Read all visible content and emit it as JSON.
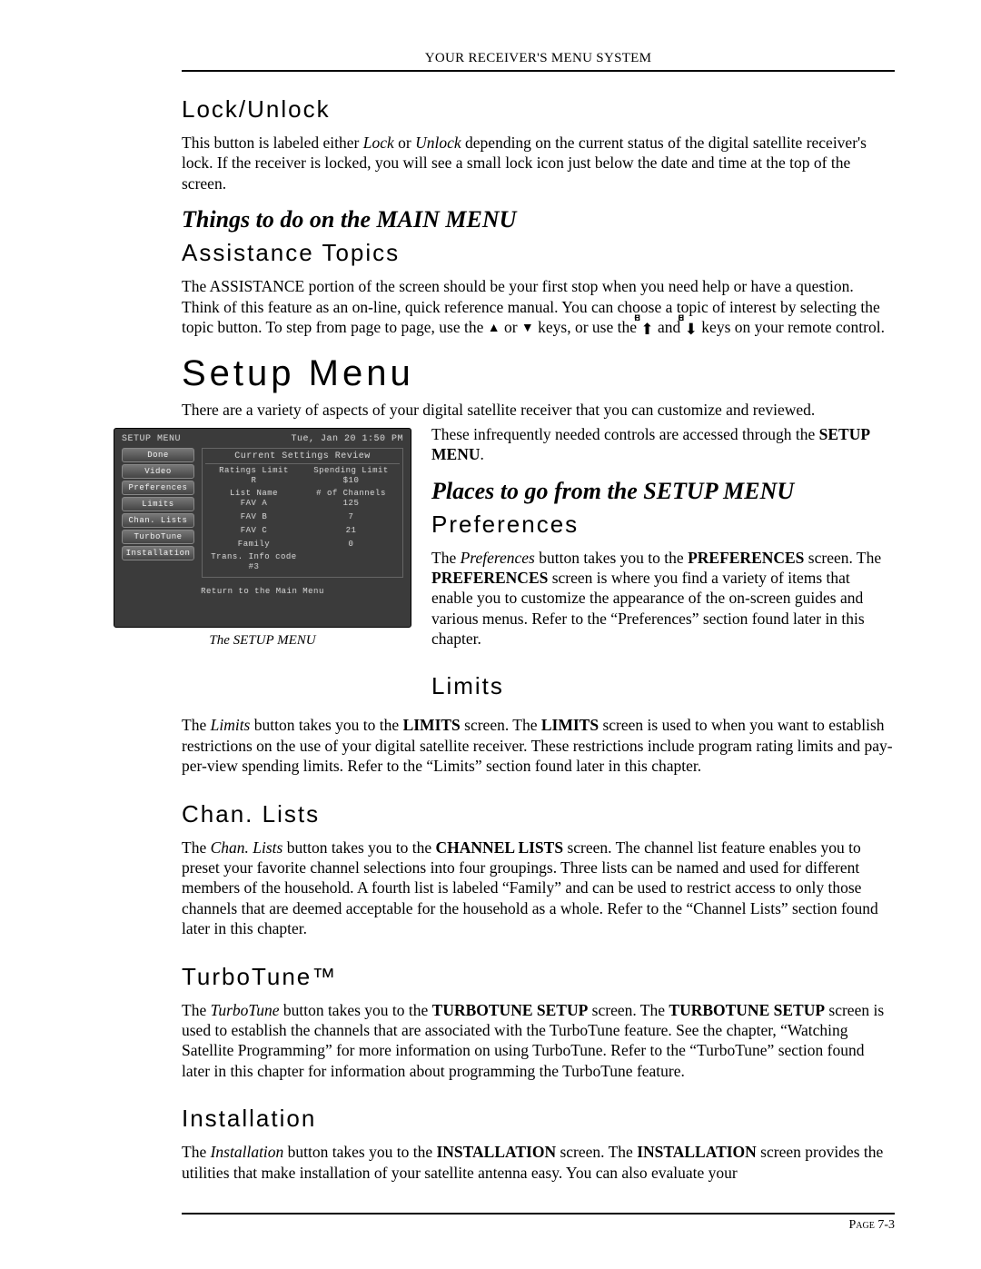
{
  "header": "YOUR RECEIVER'S MENU SYSTEM",
  "lockunlock": {
    "title": "Lock/Unlock",
    "p1_a": "This button is labeled either ",
    "p1_lock": "Lock",
    "p1_b": " or ",
    "p1_unlock": "Unlock",
    "p1_c": "  depending on the current status of the digital satellite receiver's lock.  If the receiver is locked, you will see a small lock icon just below the date and time at the top of the screen."
  },
  "things": {
    "title": "Things to do on the MAIN MENU",
    "assist_title": "Assistance Topics",
    "p_a": "The ASSISTANCE portion of the screen should be your first stop when you need help or have a question.  Think of this feature as an on-line, quick reference manual.  You can choose a topic of interest by selecting the topic button. To step from page to page, use the ",
    "p_b": " or ",
    "p_c": " keys, or use the ",
    "p_d": " and ",
    "p_e": " keys on your remote control."
  },
  "setupmenu": {
    "title": "Setup Menu",
    "intro": "There are a variety of aspects of your digital satellite receiver that you can customize and reviewed.",
    "aside_a": "These infrequently needed controls are accessed through the ",
    "aside_b": "SETUP MENU",
    "aside_c": "."
  },
  "fig": {
    "title": "SETUP MENU",
    "date": "Tue, Jan 20  1:50 PM",
    "buttons": [
      "Done",
      "Video",
      "Preferences",
      "Limits",
      "Chan. Lists",
      "TurboTune",
      "Installation"
    ],
    "panel_title": "Current Settings Review",
    "rows": [
      {
        "l1": "Ratings Limit",
        "l2": "R",
        "r1": "Spending Limit",
        "r2": "$10"
      },
      {
        "l1": "List Name",
        "l2": "FAV A",
        "r1": "# of Channels",
        "r2": "125"
      },
      {
        "l1": "",
        "l2": "FAV B",
        "r1": "",
        "r2": "7"
      },
      {
        "l1": "",
        "l2": "FAV C",
        "r1": "",
        "r2": "21"
      },
      {
        "l1": "",
        "l2": "Family",
        "r1": "",
        "r2": "0"
      },
      {
        "l1": "Trans. Info code",
        "l2": "#3",
        "r1": "",
        "r2": ""
      }
    ],
    "footer": "Return to the Main Menu",
    "caption": "The SETUP MENU"
  },
  "places": {
    "title": "Places to go from the SETUP MENU",
    "prefs_title": "Preferences",
    "prefs_a": "The ",
    "prefs_b": "Preferences",
    "prefs_c": " button takes you to the ",
    "prefs_d": "PREFERENCES",
    "prefs_e": " screen.  The ",
    "prefs_f": "PREFERENCES",
    "prefs_g": "  screen is where you find a variety of items that enable you to customize the appearance of the on-screen guides and various menus. Refer to the “Preferences” section found later in this chapter.",
    "limits_title": "Limits"
  },
  "limits": {
    "a": "The ",
    "b": "Limits",
    "c": " button takes you to the ",
    "d": "LIMITS",
    "e": " screen.  The ",
    "f": "LIMITS",
    "g": "  screen is used to when you want to  establish restrictions on the use of your digital satellite receiver.  These restrictions include program rating limits and pay-per-view spending limits. Refer to the “Limits” section found later in this chapter."
  },
  "chanlists": {
    "title": "Chan. Lists",
    "a": "The ",
    "b": "Chan. Lists",
    "c": " button takes you to the ",
    "d": "CHANNEL LISTS",
    "e": " screen.  The channel list feature enables you to preset your favorite channel selections into four groupings.  Three lists can be named and used for different members of the household.  A fourth list is labeled “Family” and can be used to restrict access to only those channels that are deemed acceptable for the household as a whole. Refer to the “Channel Lists” section found later in this chapter."
  },
  "turbotune": {
    "title": "TurboTune™",
    "a": "The ",
    "b": "TurboTune",
    "c": " button takes you to the ",
    "d": "TURBOTUNE SETUP",
    "e": " screen.  The ",
    "f": "TURBOTUNE SETUP",
    "g": " screen is used to establish the channels that are associated with the TurboTune feature.  See the chapter, “Watching Satellite Programming” for more information on using TurboTune. Refer to the “TurboTune” section found later in this chapter for information about programming the TurboTune feature."
  },
  "installation": {
    "title": "Installation",
    "a": "The ",
    "b": "Installation",
    "c": " button takes you to the ",
    "d": "INSTALLATION",
    "e": " screen. The  ",
    "f": "INSTALLATION",
    "g": " screen provides the utilities that make installation of your satellite antenna easy. You can also evaluate your"
  },
  "footer": {
    "page_label": "Page",
    "page_num": "7-3"
  }
}
